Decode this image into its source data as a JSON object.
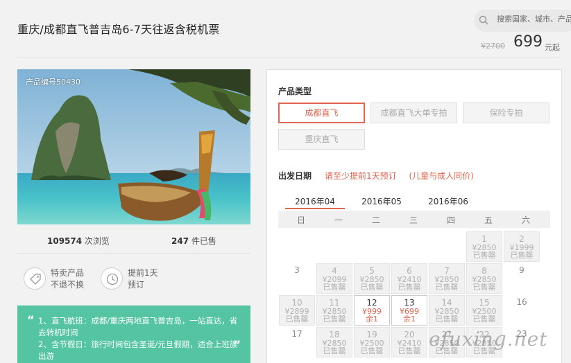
{
  "header": {
    "title": "重庆/成都直飞普吉岛6-7天往返含税机票",
    "search_placeholder": "搜索国家、城市、产品",
    "price_old": "¥2700",
    "price_now": "699",
    "price_unit": "元起"
  },
  "product": {
    "code_label": "产品编号50430",
    "views_count": "109574",
    "views_label": " 次浏览",
    "sold_count": "247",
    "sold_label": " 件已售"
  },
  "features": [
    {
      "line1": "特卖产品",
      "line2": "不退不换",
      "icon": "tag-icon"
    },
    {
      "line1": "提前1天",
      "line2": "预订",
      "icon": "clock-icon"
    }
  ],
  "notice": {
    "lines": [
      "1、直飞航班：成都/重庆两地直飞普吉岛，一站直达，省去转机时间",
      "2、含节假日：旅行时间包含圣诞/元旦假期，适合上班族出游"
    ],
    "open_quote": "“",
    "close_quote": "”"
  },
  "product_type": {
    "label": "产品类型",
    "options": [
      "成都直飞",
      "成都直飞大单专拍",
      "保险专拍",
      "重庆直飞"
    ],
    "selected": "成都直飞"
  },
  "departure": {
    "label": "出发日期",
    "notes": [
      "请至少提前1天预订",
      "(儿童与成人同价)"
    ],
    "months": [
      "2016年04",
      "2016年05",
      "2016年06"
    ],
    "weekdays": [
      "日",
      "一",
      "二",
      "三",
      "四",
      "五",
      "六"
    ],
    "days": [
      {
        "day": "1",
        "price": "¥2850",
        "status": "已售罄",
        "type": "sold",
        "col": 5,
        "row": 0
      },
      {
        "day": "2",
        "price": "¥1999",
        "status": "已售罄",
        "type": "sold",
        "col": 6,
        "row": 0
      },
      {
        "day": "3",
        "price": "",
        "status": "",
        "type": "plain",
        "col": 0,
        "row": 1
      },
      {
        "day": "4",
        "price": "¥2099",
        "status": "已售罄",
        "type": "sold",
        "col": 1,
        "row": 1
      },
      {
        "day": "5",
        "price": "¥2850",
        "status": "已售罄",
        "type": "sold",
        "col": 2,
        "row": 1
      },
      {
        "day": "6",
        "price": "¥2410",
        "status": "已售罄",
        "type": "sold",
        "col": 3,
        "row": 1
      },
      {
        "day": "7",
        "price": "¥2850",
        "status": "已售罄",
        "type": "sold",
        "col": 4,
        "row": 1
      },
      {
        "day": "8",
        "price": "¥2850",
        "status": "已售罄",
        "type": "sold",
        "col": 5,
        "row": 1
      },
      {
        "day": "9",
        "price": "",
        "status": "",
        "type": "plain",
        "col": 6,
        "row": 1
      },
      {
        "day": "10",
        "price": "¥2899",
        "status": "已售罄",
        "type": "sold",
        "col": 0,
        "row": 2
      },
      {
        "day": "11",
        "price": "¥2850",
        "status": "已售罄",
        "type": "sold",
        "col": 1,
        "row": 2
      },
      {
        "day": "12",
        "price": "¥999",
        "status": "余1",
        "type": "avail",
        "col": 2,
        "row": 2
      },
      {
        "day": "13",
        "price": "¥699",
        "status": "余1",
        "type": "avail",
        "col": 3,
        "row": 2
      },
      {
        "day": "14",
        "price": "¥2850",
        "status": "已售罄",
        "type": "sold",
        "col": 4,
        "row": 2
      },
      {
        "day": "15",
        "price": "¥2500",
        "status": "已售罄",
        "type": "sold",
        "col": 5,
        "row": 2
      },
      {
        "day": "16",
        "price": "",
        "status": "",
        "type": "plain",
        "col": 6,
        "row": 2
      },
      {
        "day": "17",
        "price": "",
        "status": "",
        "type": "plain",
        "col": 0,
        "row": 3
      },
      {
        "day": "18",
        "price": "¥2850",
        "status": "已售罄",
        "type": "sold",
        "col": 1,
        "row": 3
      },
      {
        "day": "19",
        "price": "¥2500",
        "status": "已售罄",
        "type": "sold",
        "col": 2,
        "row": 3
      },
      {
        "day": "20",
        "price": "¥2410",
        "status": "已售罄",
        "type": "sold",
        "col": 3,
        "row": 3
      },
      {
        "day": "21",
        "price": "¥2850",
        "status": "已售罄",
        "type": "sold",
        "col": 4,
        "row": 3
      },
      {
        "day": "22",
        "price": "¥2850",
        "status": "已售罄",
        "type": "sold",
        "col": 5,
        "row": 3
      },
      {
        "day": "23",
        "price": "",
        "status": "",
        "type": "plain",
        "col": 6,
        "row": 3
      }
    ]
  },
  "watermark": "efuxing.net",
  "colors": {
    "accent": "#e0664f",
    "notice_bg": "#55c4a2"
  }
}
